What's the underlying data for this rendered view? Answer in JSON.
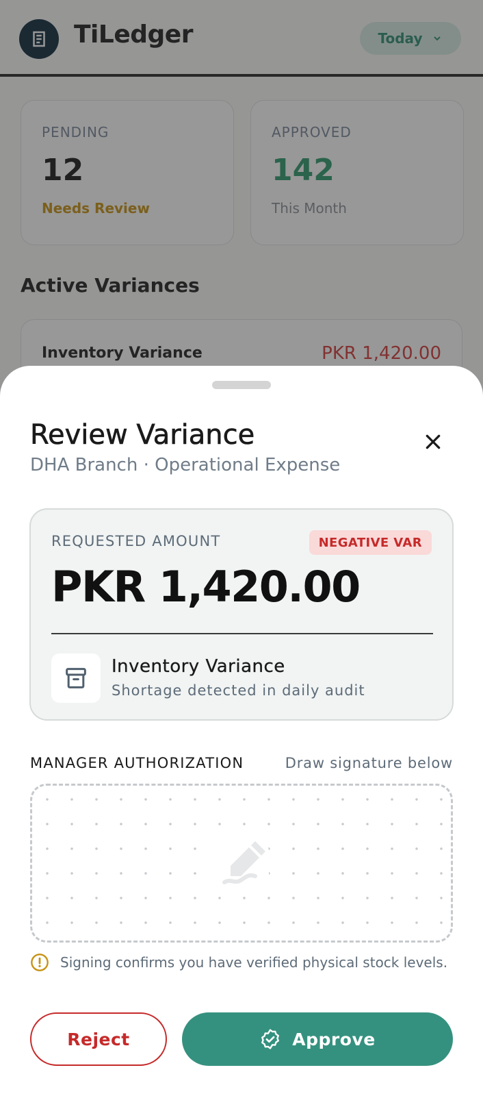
{
  "app": {
    "title": "TiLedger",
    "date_filter": "Today"
  },
  "stats": [
    {
      "label": "PENDING",
      "value": "12",
      "sub": "Needs Review"
    },
    {
      "label": "APPROVED",
      "value": "142",
      "sub": "This Month"
    }
  ],
  "active_variances": {
    "title": "Active Variances",
    "items": [
      {
        "title": "Inventory Variance",
        "amount": "PKR 1,420.00"
      }
    ]
  },
  "sheet": {
    "title": "Review Variance",
    "subtitle": "DHA Branch · Operational Expense",
    "amount_card": {
      "label": "REQUESTED AMOUNT",
      "badge": "NEGATIVE VAR",
      "amount": "PKR 1,420.00",
      "variance_title": "Inventory Variance",
      "variance_desc": "Shortage detected in daily audit"
    },
    "authorization": {
      "label": "MANAGER AUTHORIZATION",
      "hint": "Draw signature below"
    },
    "notice": "Signing confirms you have verified physical stock levels.",
    "buttons": {
      "reject": "Reject",
      "approve": "Approve"
    }
  },
  "colors": {
    "primary": "#35917f",
    "danger": "#c62a2a",
    "warning": "#c79213",
    "brand_dark": "#0f2b3c"
  },
  "icons": {
    "logo": "ledger-logo-icon",
    "close": "close-icon",
    "inventory": "archive-box-icon",
    "signature_placeholder": "pen-draw-icon",
    "notice": "info-circle-icon",
    "approve": "verified-badge-icon",
    "dropdown": "chevron-down-icon"
  }
}
